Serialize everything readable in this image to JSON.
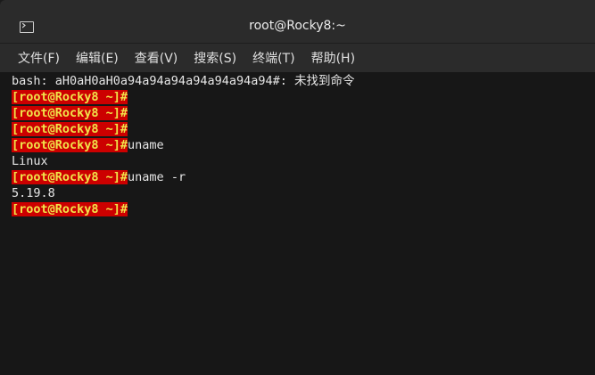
{
  "window": {
    "title": "root@Rocky8:~"
  },
  "menu": [
    {
      "label": "文件(F)"
    },
    {
      "label": "编辑(E)"
    },
    {
      "label": "查看(V)"
    },
    {
      "label": "搜索(S)"
    },
    {
      "label": "终端(T)"
    },
    {
      "label": "帮助(H)"
    }
  ],
  "terminal": {
    "prompt": "[root@Rocky8 ~]#",
    "lines": [
      {
        "text": "bash: aH0aH0aH0a94a94a94a94a94a94a94#: 未找到命令"
      },
      {
        "prompt": true,
        "cmd": ""
      },
      {
        "prompt": true,
        "cmd": ""
      },
      {
        "prompt": true,
        "cmd": ""
      },
      {
        "prompt": true,
        "cmd": "uname"
      },
      {
        "text": "Linux"
      },
      {
        "prompt": true,
        "cmd": "uname -r"
      },
      {
        "text": "5.19.8"
      },
      {
        "prompt": true,
        "cmd": ""
      }
    ]
  },
  "icons": {
    "app": "terminal-icon"
  },
  "colors": {
    "prompt_bg": "#cc0000",
    "prompt_fg": "#f0e44a",
    "terminal_bg": "#171717",
    "chrome_bg": "#2b2b2b"
  }
}
